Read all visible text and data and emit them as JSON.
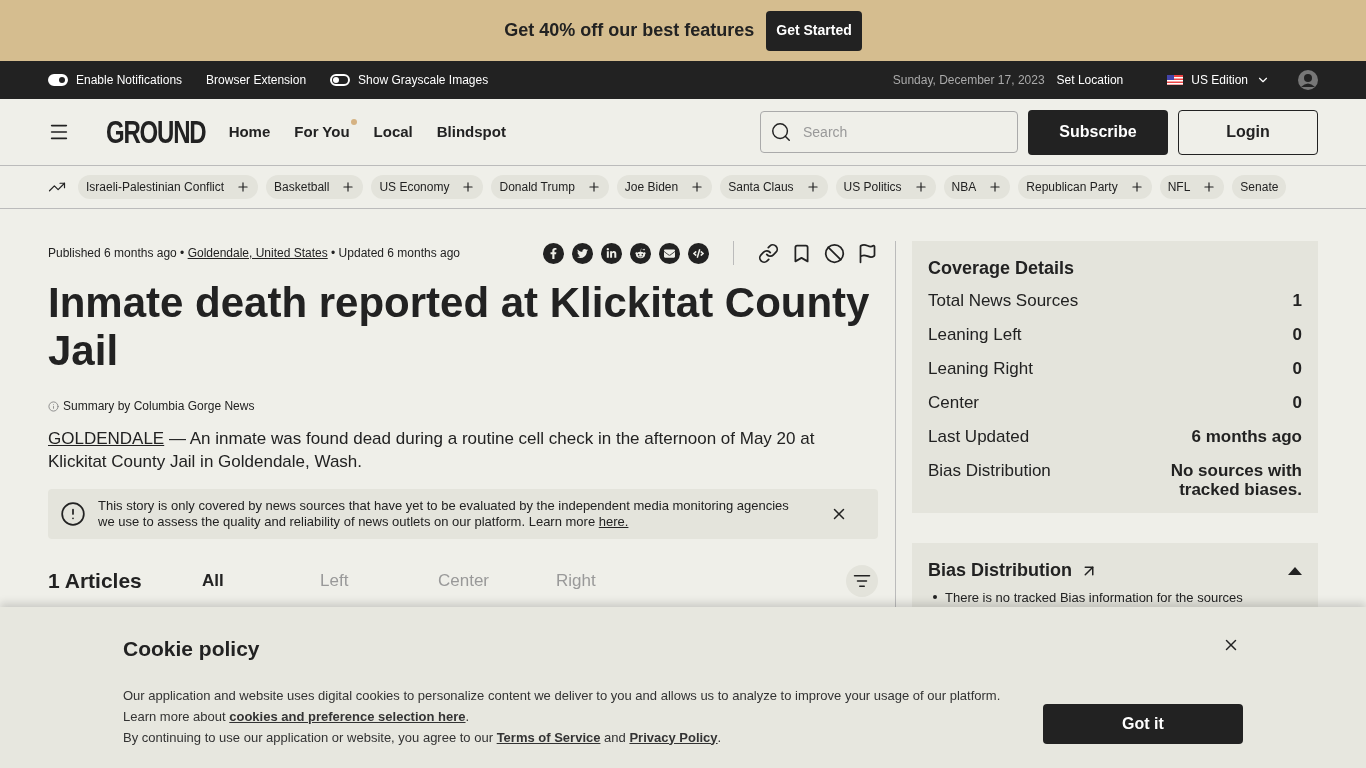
{
  "promo": {
    "text": "Get 40% off our best features",
    "button": "Get Started"
  },
  "topbar": {
    "toggles": [
      {
        "label": "Enable Notifications",
        "on": true
      },
      {
        "label": "Show Grayscale Images",
        "on": false
      }
    ],
    "extension": "Browser Extension",
    "date": "Sunday, December 17, 2023",
    "set_location": "Set Location",
    "edition": "US Edition"
  },
  "header": {
    "logo": "GROUND",
    "nav": [
      {
        "label": "Home",
        "dot": false
      },
      {
        "label": "For You",
        "dot": true
      },
      {
        "label": "Local",
        "dot": false
      },
      {
        "label": "Blindspot",
        "dot": false
      }
    ],
    "search": {
      "placeholder": "Search"
    },
    "subscribe": "Subscribe",
    "login": "Login"
  },
  "topics": [
    {
      "label": "Israeli-Palestinian Conflict",
      "add": true
    },
    {
      "label": "Basketball",
      "add": true
    },
    {
      "label": "US Economy",
      "add": true
    },
    {
      "label": "Donald Trump",
      "add": true
    },
    {
      "label": "Joe Biden",
      "add": true
    },
    {
      "label": "Santa Claus",
      "add": true
    },
    {
      "label": "US Politics",
      "add": true
    },
    {
      "label": "NBA",
      "add": true
    },
    {
      "label": "Republican Party",
      "add": true
    },
    {
      "label": "NFL",
      "add": true
    },
    {
      "label": "Senate",
      "add": false
    }
  ],
  "article": {
    "meta": {
      "published": "Published 6 months ago •",
      "location": "Goldendale, United States",
      "updated": "• Updated 6 months ago"
    },
    "title": "Inmate death reported at Klickitat County Jail",
    "summary_by": "Summary by Columbia Gorge News",
    "lead": {
      "place": "GOLDENDALE",
      "text": "— An inmate was found dead during a routine cell check in the afternoon of May 20 at Klickitat County Jail in Goldendale, Wash."
    },
    "notice": {
      "text": "This story is only covered by news sources that have yet to be evaluated by the independent media monitoring agencies we use to assess the quality and reliability of news outlets on our platform. Learn more",
      "link": "here."
    },
    "count": "1 Articles",
    "tabs": [
      {
        "label": "All",
        "selected": true
      },
      {
        "label": "Left",
        "selected": false
      },
      {
        "label": "Center",
        "selected": false
      },
      {
        "label": "Right",
        "selected": false
      }
    ]
  },
  "coverage": {
    "title": "Coverage Details",
    "rows": [
      {
        "label": "Total News Sources",
        "value": "1"
      },
      {
        "label": "Leaning Left",
        "value": "0"
      },
      {
        "label": "Leaning Right",
        "value": "0"
      },
      {
        "label": "Center",
        "value": "0"
      },
      {
        "label": "Last Updated",
        "value": "6 months ago"
      },
      {
        "label": "Bias Distribution",
        "value": "No sources with tracked biases."
      }
    ]
  },
  "bias": {
    "title": "Bias Distribution",
    "expanded": true,
    "bullet": "There is no tracked Bias information for the sources"
  },
  "cookie": {
    "title": "Cookie policy",
    "p1": "Our application and website uses digital cookies to personalize content we deliver to you and allows us to analyze to improve your usage of our platform. Learn more about",
    "p1_link": "cookies and preference selection here",
    "p1_end": ".",
    "p2": "By continuing to use our application or website, you agree to our",
    "terms": "Terms of Service",
    "and": "and",
    "privacy": "Privacy Policy",
    "p2_end": ".",
    "button": "Got it"
  }
}
